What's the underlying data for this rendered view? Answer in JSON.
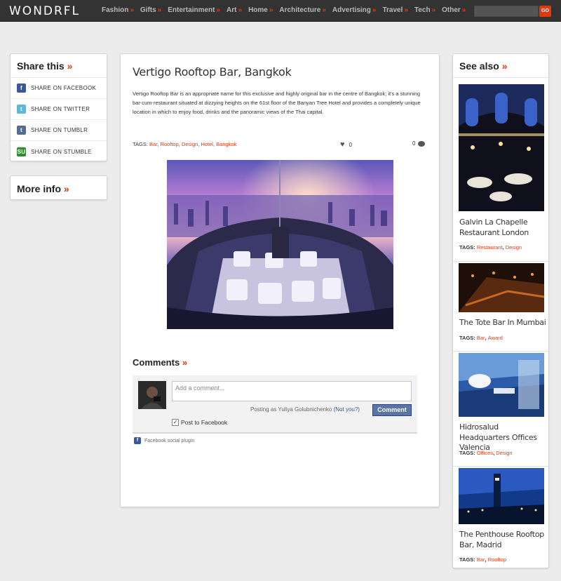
{
  "brand": "WONDRFL",
  "nav": [
    "Fashion",
    "Gifts",
    "Entertainment",
    "Art",
    "Home",
    "Architecture",
    "Advertising",
    "Travel",
    "Tech",
    "Other"
  ],
  "nav_suffix": "»",
  "search": {
    "placeholder": "",
    "button": "GO"
  },
  "share": {
    "title": "Share this",
    "items": [
      "SHARE ON FACEBOOK",
      "SHARE ON TWITTER",
      "SHARE ON TUMBLR",
      "SHARE ON STUMBLE"
    ]
  },
  "more_info": {
    "title": "More info"
  },
  "article": {
    "title": "Vertigo Rooftop Bar, Bangkok",
    "body": "Vertigo Rooftop Bar is an appropriate name for this exclusive and highly original bar in the centre of Bangkok; it's a stunning bar-cum-restaurant situated at dizzying heights on the 61st floor of the Banyan Tree Hotel and provides a completely unique location in which to enjoy food, drinks and the panoramic views of the Thai capital.",
    "tags_label": "TAGS:",
    "tags": [
      "Bar",
      "Rooftop",
      "Design",
      "Hotel",
      "Bangkok"
    ],
    "likes": "0",
    "comments": "0"
  },
  "comments": {
    "title": "Comments",
    "placeholder": "Add a comment...",
    "posting_as": "Posting as Yuliya Golubnichenko",
    "not_you": "(Not you?)",
    "button": "Comment",
    "post_to_facebook": "Post to Facebook",
    "plugin_label": "Facebook social plugin"
  },
  "see_also": {
    "title": "See also",
    "tags_label": "TAGS:",
    "items": [
      {
        "name": "Galvin La Chapelle Restaurant London",
        "tags": [
          "Restaurant",
          "Design"
        ]
      },
      {
        "name": "The Tote Bar In Mumbai",
        "tags": [
          "Bar",
          "Award"
        ]
      },
      {
        "name": "Hidrosalud Headquarters Offices Valencia",
        "tags": [
          "Offices",
          "Design"
        ]
      },
      {
        "name": "The Penthouse Rooftop Bar, Madrid",
        "tags": [
          "Bar",
          "Rooftop"
        ]
      }
    ]
  },
  "colors": {
    "accent": "#e2380f",
    "topbar": "#333333",
    "background": "#ececec"
  }
}
